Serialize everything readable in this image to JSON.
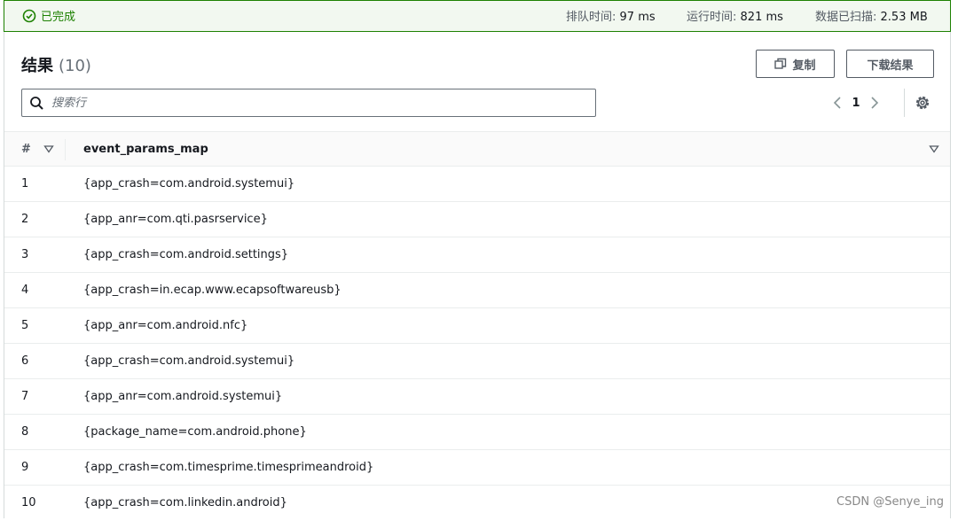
{
  "status": {
    "state": "已完成",
    "queue_label": "排队时间:",
    "queue_value": "97 ms",
    "run_label": "运行时间:",
    "run_value": "821 ms",
    "scan_label": "数据已扫描:",
    "scan_value": "2.53 MB"
  },
  "results": {
    "title": "结果",
    "count": "(10)",
    "copy_label": "复制",
    "download_label": "下载结果"
  },
  "search": {
    "placeholder": "搜索行"
  },
  "pagination": {
    "current_page": "1"
  },
  "table": {
    "headers": [
      "#",
      "event_params_map"
    ],
    "rows": [
      {
        "idx": "1",
        "value": "{app_crash=com.android.systemui}"
      },
      {
        "idx": "2",
        "value": "{app_anr=com.qti.pasrservice}"
      },
      {
        "idx": "3",
        "value": "{app_crash=com.android.settings}"
      },
      {
        "idx": "4",
        "value": "{app_crash=in.ecap.www.ecapsoftwareusb}"
      },
      {
        "idx": "5",
        "value": "{app_anr=com.android.nfc}"
      },
      {
        "idx": "6",
        "value": "{app_crash=com.android.systemui}"
      },
      {
        "idx": "7",
        "value": "{app_anr=com.android.systemui}"
      },
      {
        "idx": "8",
        "value": "{package_name=com.android.phone}"
      },
      {
        "idx": "9",
        "value": "{app_crash=com.timesprime.timesprimeandroid}"
      },
      {
        "idx": "10",
        "value": "{app_crash=com.linkedin.android}"
      }
    ]
  },
  "watermark": "CSDN @Senye_ing",
  "colors": {
    "success": "#1d8102",
    "border": "#d5dbdb",
    "text": "#16191f",
    "muted": "#545b64"
  },
  "icons": [
    "check-circle-icon",
    "copy-icon",
    "search-icon",
    "chevron-left-icon",
    "chevron-right-icon",
    "gear-icon",
    "sort-down-icon"
  ]
}
